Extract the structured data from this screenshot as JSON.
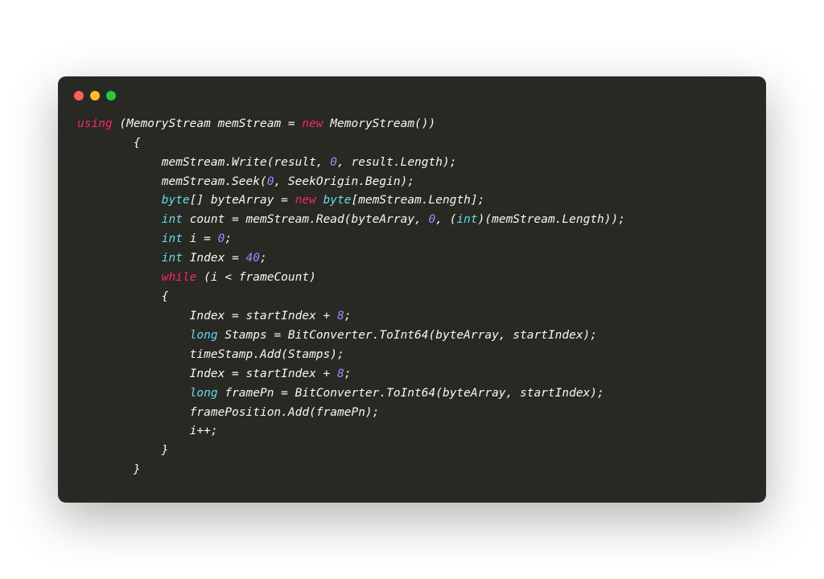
{
  "colors": {
    "window_bg": "#282923",
    "text": "#f8f8f2",
    "keyword": "#f92672",
    "type": "#66d9ef",
    "number": "#ae81ff",
    "dot_red": "#ff5f56",
    "dot_yellow": "#ffbd2e",
    "dot_green": "#27c93f"
  },
  "code": {
    "full_text": "using (MemoryStream memStream = new MemoryStream())\n        {\n            memStream.Write(result, 0, result.Length);\n            memStream.Seek(0, SeekOrigin.Begin);\n            byte[] byteArray = new byte[memStream.Length];\n            int count = memStream.Read(byteArray, 0, (int)(memStream.Length));\n            int i = 0;\n            int Index = 40;\n            while (i < frameCount)\n            {\n                Index = startIndex + 8;\n                long Stamps = BitConverter.ToInt64(byteArray, startIndex);\n                timeStamp.Add(Stamps);\n                Index = startIndex + 8;\n                long framePn = BitConverter.ToInt64(byteArray, startIndex);\n                framePosition.Add(framePn);\n                i++;\n            }\n        }",
    "tokens": [
      [
        [
          "using",
          "kw"
        ],
        [
          " (MemoryStream memStream = ",
          "plain"
        ],
        [
          "new",
          "kw"
        ],
        [
          " MemoryStream())",
          "plain"
        ]
      ],
      [
        [
          "        {",
          "plain"
        ]
      ],
      [
        [
          "            memStream.Write(result, ",
          "plain"
        ],
        [
          "0",
          "num"
        ],
        [
          ", result.Length);",
          "plain"
        ]
      ],
      [
        [
          "            memStream.Seek(",
          "plain"
        ],
        [
          "0",
          "num"
        ],
        [
          ", SeekOrigin.Begin);",
          "plain"
        ]
      ],
      [
        [
          "            ",
          "plain"
        ],
        [
          "byte",
          "type"
        ],
        [
          "[] byteArray = ",
          "plain"
        ],
        [
          "new",
          "kw"
        ],
        [
          " ",
          "plain"
        ],
        [
          "byte",
          "type"
        ],
        [
          "[memStream.Length];",
          "plain"
        ]
      ],
      [
        [
          "            ",
          "plain"
        ],
        [
          "int",
          "type"
        ],
        [
          " count = memStream.Read(byteArray, ",
          "plain"
        ],
        [
          "0",
          "num"
        ],
        [
          ", (",
          "plain"
        ],
        [
          "int",
          "type"
        ],
        [
          ")(memStream.Length));",
          "plain"
        ]
      ],
      [
        [
          "            ",
          "plain"
        ],
        [
          "int",
          "type"
        ],
        [
          " i = ",
          "plain"
        ],
        [
          "0",
          "num"
        ],
        [
          ";",
          "plain"
        ]
      ],
      [
        [
          "            ",
          "plain"
        ],
        [
          "int",
          "type"
        ],
        [
          " Index = ",
          "plain"
        ],
        [
          "40",
          "num"
        ],
        [
          ";",
          "plain"
        ]
      ],
      [
        [
          "            ",
          "plain"
        ],
        [
          "while",
          "kw"
        ],
        [
          " (i < frameCount)",
          "plain"
        ]
      ],
      [
        [
          "            {",
          "plain"
        ]
      ],
      [
        [
          "                Index = startIndex + ",
          "plain"
        ],
        [
          "8",
          "num"
        ],
        [
          ";",
          "plain"
        ]
      ],
      [
        [
          "                ",
          "plain"
        ],
        [
          "long",
          "type"
        ],
        [
          " Stamps = BitConverter.ToInt64(byteArray, startIndex);",
          "plain"
        ]
      ],
      [
        [
          "                timeStamp.Add(Stamps);",
          "plain"
        ]
      ],
      [
        [
          "                Index = startIndex + ",
          "plain"
        ],
        [
          "8",
          "num"
        ],
        [
          ";",
          "plain"
        ]
      ],
      [
        [
          "                ",
          "plain"
        ],
        [
          "long",
          "type"
        ],
        [
          " framePn = BitConverter.ToInt64(byteArray, startIndex);",
          "plain"
        ]
      ],
      [
        [
          "                framePosition.Add(framePn);",
          "plain"
        ]
      ],
      [
        [
          "                i++;",
          "plain"
        ]
      ],
      [
        [
          "            }",
          "plain"
        ]
      ],
      [
        [
          "        }",
          "plain"
        ]
      ]
    ]
  }
}
